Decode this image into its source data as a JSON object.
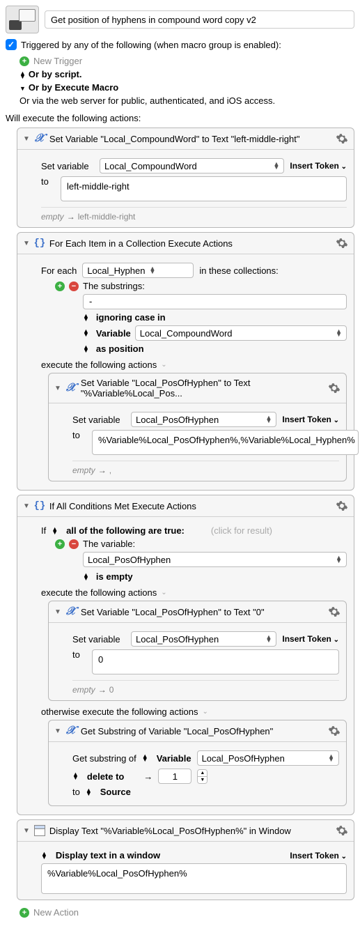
{
  "header": {
    "title": "Get position of hyphens in compound word copy v2"
  },
  "trigger": {
    "label": "Triggered by any of the following (when macro group is enabled):",
    "new_trigger": "New Trigger",
    "by_script": "Or by script.",
    "by_execute": "Or by Execute Macro",
    "via_web": "Or via the web server for public, authenticated, and iOS access."
  },
  "exec_label": "Will execute the following actions:",
  "actions": {
    "a1": {
      "title": "Set Variable \"Local_CompoundWord\" to Text \"left-middle-right\"",
      "set_var_label": "Set variable",
      "var_name": "Local_CompoundWord",
      "insert_token": "Insert Token",
      "to_label": "to",
      "text_value": "left-middle-right",
      "status_from": "empty",
      "status_to": "left-middle-right"
    },
    "a2": {
      "title": "For Each Item in a Collection Execute Actions",
      "for_each_label": "For each",
      "var_name": "Local_Hyphen",
      "in_collections": "in these collections:",
      "substrings_label": "The substrings:",
      "substring_value": "-",
      "ignoring_case": "ignoring case in",
      "variable_label": "Variable",
      "variable_value": "Local_CompoundWord",
      "as_position": "as position",
      "exec_label": "execute the following actions",
      "inner": {
        "title": "Set Variable \"Local_PosOfHyphen\" to Text \"%Variable%Local_Pos...",
        "set_var_label": "Set variable",
        "var_name": "Local_PosOfHyphen",
        "insert_token": "Insert Token",
        "to_label": "to",
        "text_value": "%Variable%Local_PosOfHyphen%,%Variable%Local_Hyphen%",
        "status_from": "empty",
        "status_to": ","
      }
    },
    "a3": {
      "title": "If All Conditions Met Execute Actions",
      "if_label": "If",
      "all_true": "all of the following are true:",
      "click_result": "(click for result)",
      "the_variable": "The variable:",
      "cond_var": "Local_PosOfHyphen",
      "is_empty": "is empty",
      "exec_label": "execute the following actions",
      "then": {
        "title": "Set Variable \"Local_PosOfHyphen\" to Text \"0\"",
        "set_var_label": "Set variable",
        "var_name": "Local_PosOfHyphen",
        "insert_token": "Insert Token",
        "to_label": "to",
        "text_value": "0",
        "status_from": "empty",
        "status_to": "0"
      },
      "otherwise_label": "otherwise execute the following actions",
      "else": {
        "title": "Get Substring of Variable \"Local_PosOfHyphen\"",
        "get_sub_label": "Get substring of",
        "variable_label": "Variable",
        "var_name": "Local_PosOfHyphen",
        "delete_to": "delete to",
        "arrow": "→",
        "num": "1",
        "to_label": "to",
        "source": "Source"
      }
    },
    "a4": {
      "title": "Display Text \"%Variable%Local_PosOfHyphen%\" in Window",
      "display_label": "Display text in a window",
      "insert_token": "Insert Token",
      "text_value": "%Variable%Local_PosOfHyphen%"
    }
  },
  "new_action": "New Action"
}
